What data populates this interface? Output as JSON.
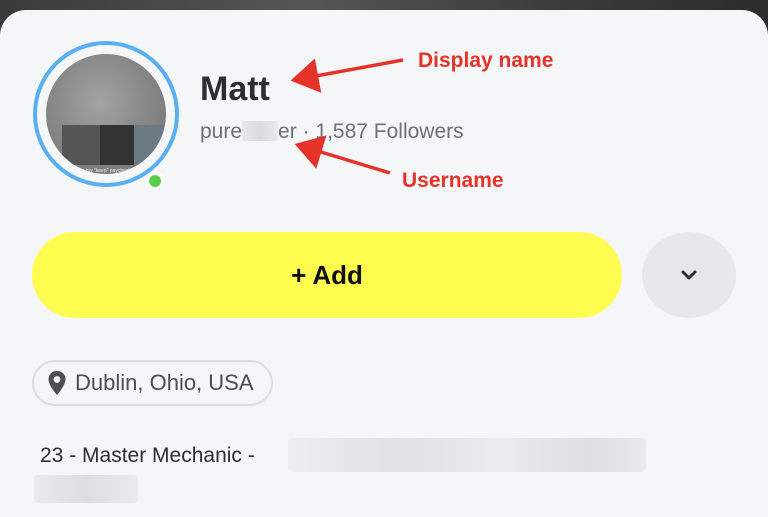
{
  "profile": {
    "display_name": "Matt",
    "username_visible_start": "pure",
    "username_visible_end": "er",
    "separator": " · ",
    "followers": "1,587 Followers",
    "avatar_caption": "It's my \"keep\" paycheck.."
  },
  "annotations": {
    "display_name": "Display name",
    "username": "Username",
    "color": "#e5332a"
  },
  "actions": {
    "add_label": "Add",
    "add_plus": "+",
    "add_color": "#fffc50",
    "more_icon": "chevron-down-icon"
  },
  "location": {
    "icon": "map-pin-icon",
    "text": "Dublin, Ohio, USA"
  },
  "bio": {
    "text": "23 - Master Mechanic -"
  },
  "colors": {
    "ring": "#5aaff0",
    "online": "#5ccd4b"
  }
}
